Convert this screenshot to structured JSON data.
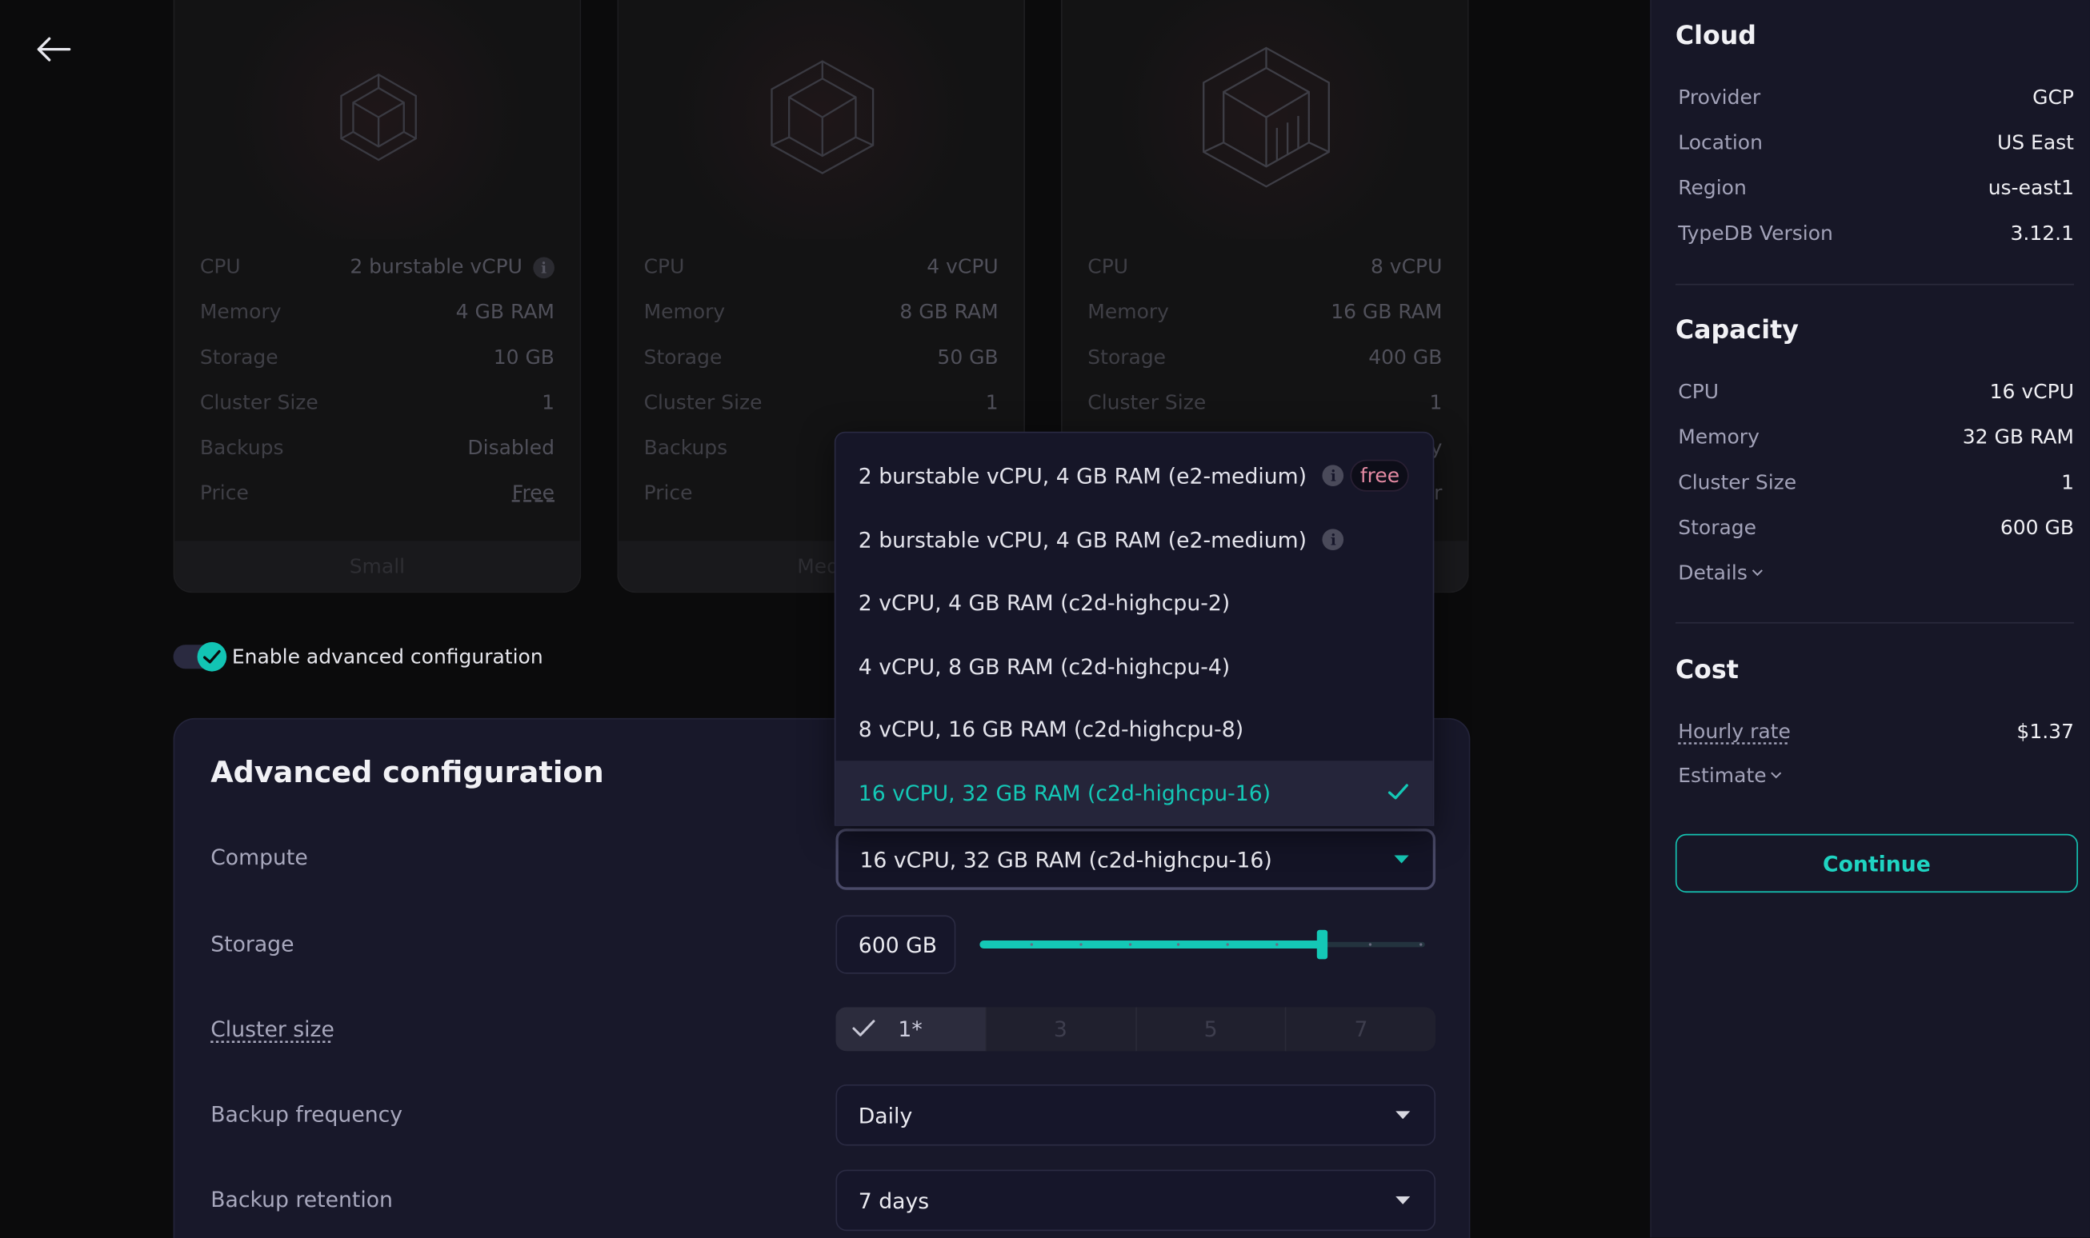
{
  "cards": [
    {
      "specs": [
        {
          "label": "CPU",
          "value": "2 burstable vCPU"
        },
        {
          "label": "Memory",
          "value": "4 GB RAM"
        },
        {
          "label": "Storage",
          "value": "10 GB"
        },
        {
          "label": "Cluster Size",
          "value": "1"
        },
        {
          "label": "Backups",
          "value": "Disabled"
        },
        {
          "label": "Price",
          "value": "Free"
        }
      ],
      "footer": "Small"
    },
    {
      "specs": [
        {
          "label": "CPU",
          "value": "4 vCPU"
        },
        {
          "label": "Memory",
          "value": "8 GB RAM"
        },
        {
          "label": "Storage",
          "value": "50 GB"
        },
        {
          "label": "Cluster Size",
          "value": "1"
        },
        {
          "label": "Backups",
          "value": ""
        },
        {
          "label": "Price",
          "value": ""
        }
      ],
      "footer": "Medi"
    },
    {
      "specs": [
        {
          "label": "CPU",
          "value": "8 vCPU"
        },
        {
          "label": "Memory",
          "value": "16 GB RAM"
        },
        {
          "label": "Storage",
          "value": "400 GB"
        },
        {
          "label": "Cluster Size",
          "value": "1"
        },
        {
          "label": "",
          "value": "y"
        },
        {
          "label": "",
          "value": "r"
        }
      ],
      "footer": ""
    }
  ],
  "advanced_toggle": {
    "label": "Enable advanced configuration",
    "enabled": true
  },
  "advanced": {
    "title": "Advanced configuration",
    "compute_label": "Compute",
    "compute_value": "16 vCPU, 32 GB RAM (c2d-highcpu-16)",
    "storage_label": "Storage",
    "storage_value": "600 GB",
    "storage_slider_fraction": 0.77,
    "cluster_label": "Cluster size",
    "cluster_options": [
      "1*",
      "3",
      "5",
      "7"
    ],
    "cluster_selected": "1*",
    "backup_frequency_label": "Backup frequency",
    "backup_frequency_value": "Daily",
    "backup_retention_label": "Backup retention",
    "backup_retention_value": "7 days"
  },
  "compute_options": [
    {
      "label": "2 burstable vCPU, 4 GB RAM (e2-medium)",
      "info": true,
      "badge": "free"
    },
    {
      "label": "2 burstable vCPU, 4 GB RAM (e2-medium)",
      "info": true,
      "badge": ""
    },
    {
      "label": "2 vCPU, 4 GB RAM (c2d-highcpu-2)",
      "info": false,
      "badge": ""
    },
    {
      "label": "4 vCPU, 8 GB RAM (c2d-highcpu-4)",
      "info": false,
      "badge": ""
    },
    {
      "label": "8 vCPU, 16 GB RAM (c2d-highcpu-8)",
      "info": false,
      "badge": ""
    },
    {
      "label": "16 vCPU, 32 GB RAM (c2d-highcpu-16)",
      "info": false,
      "badge": "",
      "selected": true
    }
  ],
  "sidebar": {
    "cloud": {
      "title": "Cloud",
      "rows": [
        {
          "k": "Provider",
          "v": "GCP"
        },
        {
          "k": "Location",
          "v": "US East"
        },
        {
          "k": "Region",
          "v": "us-east1"
        },
        {
          "k": "TypeDB Version",
          "v": "3.12.1"
        }
      ]
    },
    "capacity": {
      "title": "Capacity",
      "rows": [
        {
          "k": "CPU",
          "v": "16 vCPU"
        },
        {
          "k": "Memory",
          "v": "32 GB RAM"
        },
        {
          "k": "Cluster Size",
          "v": "1"
        },
        {
          "k": "Storage",
          "v": "600 GB"
        }
      ],
      "details_label": "Details"
    },
    "cost": {
      "title": "Cost",
      "hourly_label": "Hourly rate",
      "hourly_value": "$1.37",
      "estimate_label": "Estimate"
    },
    "continue_label": "Continue"
  },
  "colors": {
    "accent": "#14c8b6",
    "free_badge": "#e58aa3",
    "background": "#0b0b0c",
    "panel": "#18182a"
  }
}
